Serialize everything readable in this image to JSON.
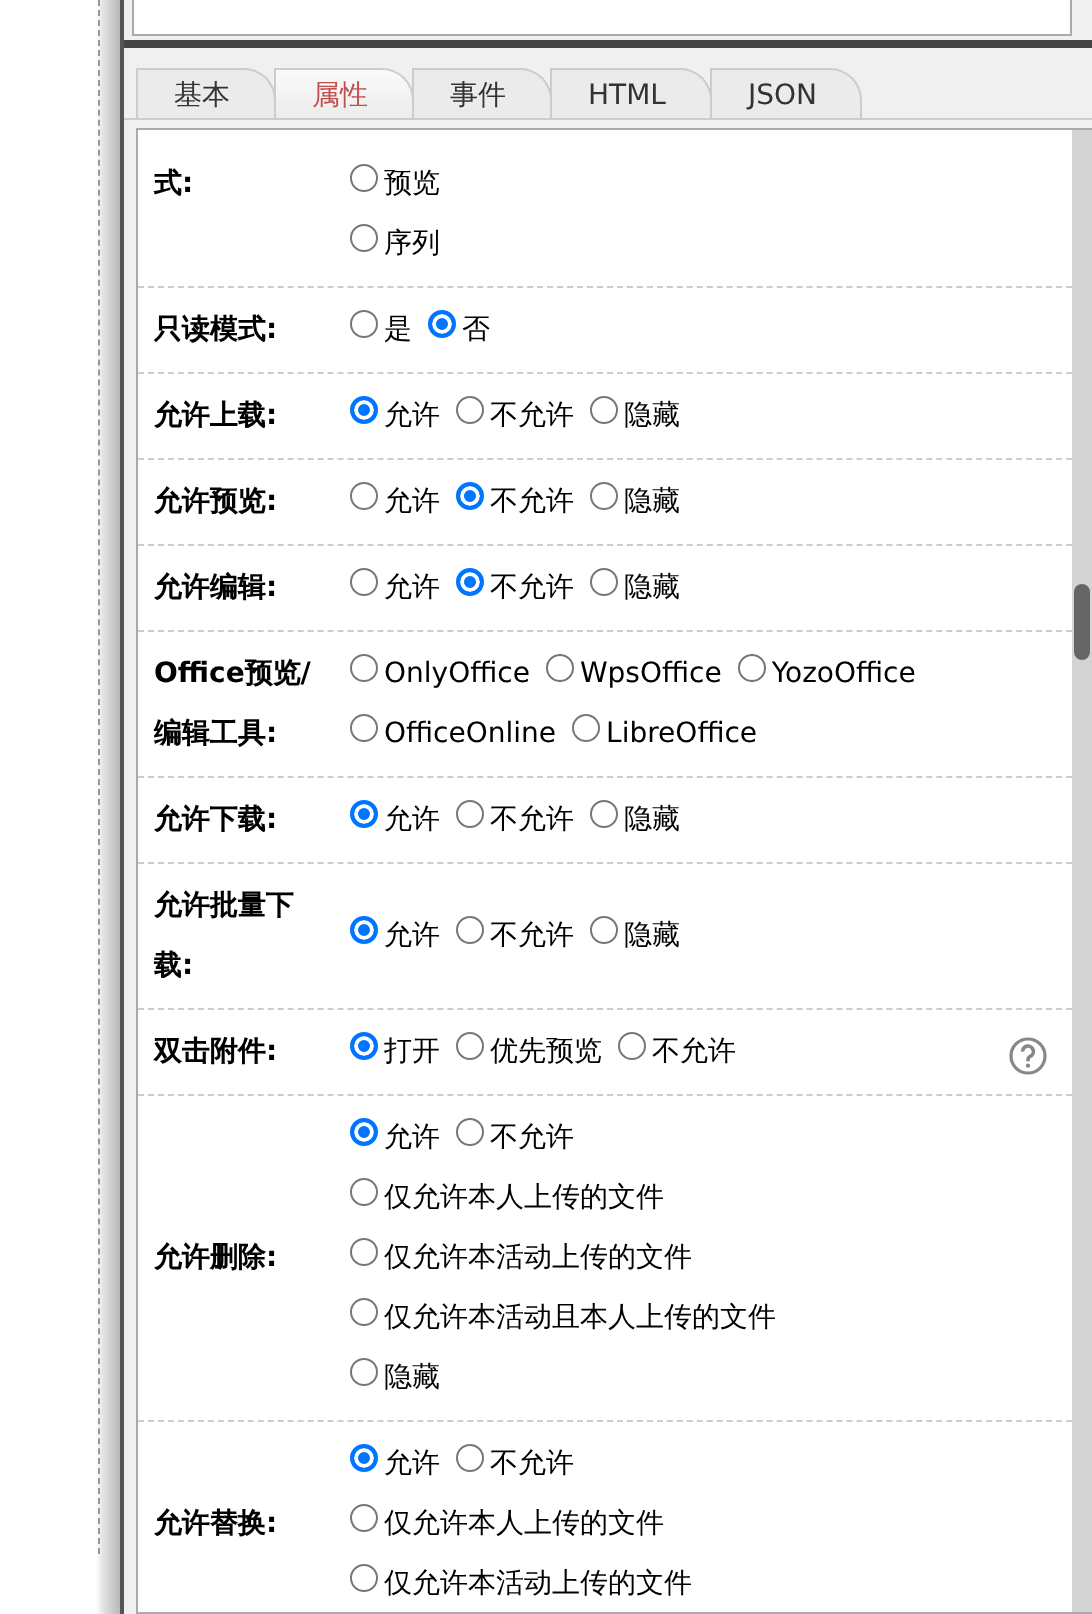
{
  "tabs": [
    {
      "label": "基本",
      "selected": false
    },
    {
      "label": "属性",
      "selected": true
    },
    {
      "label": "事件",
      "selected": false
    },
    {
      "label": "HTML",
      "selected": false
    },
    {
      "label": "JSON",
      "selected": false
    }
  ],
  "rows": [
    {
      "label": "式:",
      "option_lines": [
        [
          {
            "label": "预览",
            "selected": false
          }
        ],
        [
          {
            "label": "序列",
            "selected": false
          }
        ]
      ]
    },
    {
      "label": "只读模式:",
      "option_lines": [
        [
          {
            "label": "是",
            "selected": false
          },
          {
            "label": "否",
            "selected": true
          }
        ]
      ]
    },
    {
      "label": "允许上载:",
      "option_lines": [
        [
          {
            "label": "允许",
            "selected": true
          },
          {
            "label": "不允许",
            "selected": false
          },
          {
            "label": "隐藏",
            "selected": false
          }
        ]
      ]
    },
    {
      "label": "允许预览:",
      "option_lines": [
        [
          {
            "label": "允许",
            "selected": false
          },
          {
            "label": "不允许",
            "selected": true
          },
          {
            "label": "隐藏",
            "selected": false
          }
        ]
      ]
    },
    {
      "label": "允许编辑:",
      "option_lines": [
        [
          {
            "label": "允许",
            "selected": false
          },
          {
            "label": "不允许",
            "selected": true
          },
          {
            "label": "隐藏",
            "selected": false
          }
        ]
      ]
    },
    {
      "label": "Office预览/编辑工具:",
      "option_lines": [
        [
          {
            "label": "OnlyOffice",
            "selected": false
          },
          {
            "label": "WpsOffice",
            "selected": false
          },
          {
            "label": "YozoOffice",
            "selected": false
          },
          {
            "label": "OfficeOnline",
            "selected": false
          },
          {
            "label": "LibreOffice",
            "selected": false
          }
        ]
      ]
    },
    {
      "label": "允许下载:",
      "option_lines": [
        [
          {
            "label": "允许",
            "selected": true
          },
          {
            "label": "不允许",
            "selected": false
          },
          {
            "label": "隐藏",
            "selected": false
          }
        ]
      ]
    },
    {
      "label": "允许批量下载:",
      "option_lines": [
        [
          {
            "label": "允许",
            "selected": true
          },
          {
            "label": "不允许",
            "selected": false
          },
          {
            "label": "隐藏",
            "selected": false
          }
        ]
      ]
    },
    {
      "label": "双击附件:",
      "help": true,
      "option_lines": [
        [
          {
            "label": "打开",
            "selected": true
          },
          {
            "label": "优先预览",
            "selected": false
          },
          {
            "label": "不允许",
            "selected": false
          }
        ]
      ]
    },
    {
      "label": "允许删除:",
      "option_lines": [
        [
          {
            "label": "允许",
            "selected": true
          },
          {
            "label": "不允许",
            "selected": false
          }
        ],
        [
          {
            "label": "仅允许本人上传的文件",
            "selected": false
          }
        ],
        [
          {
            "label": "仅允许本活动上传的文件",
            "selected": false
          }
        ],
        [
          {
            "label": "仅允许本活动且本人上传的文件",
            "selected": false
          }
        ],
        [
          {
            "label": "隐藏",
            "selected": false
          }
        ]
      ]
    },
    {
      "label": "允许替换:",
      "option_lines": [
        [
          {
            "label": "允许",
            "selected": true
          },
          {
            "label": "不允许",
            "selected": false
          }
        ],
        [
          {
            "label": "仅允许本人上传的文件",
            "selected": false
          }
        ],
        [
          {
            "label": "仅允许本活动上传的文件",
            "selected": false
          }
        ]
      ]
    }
  ]
}
